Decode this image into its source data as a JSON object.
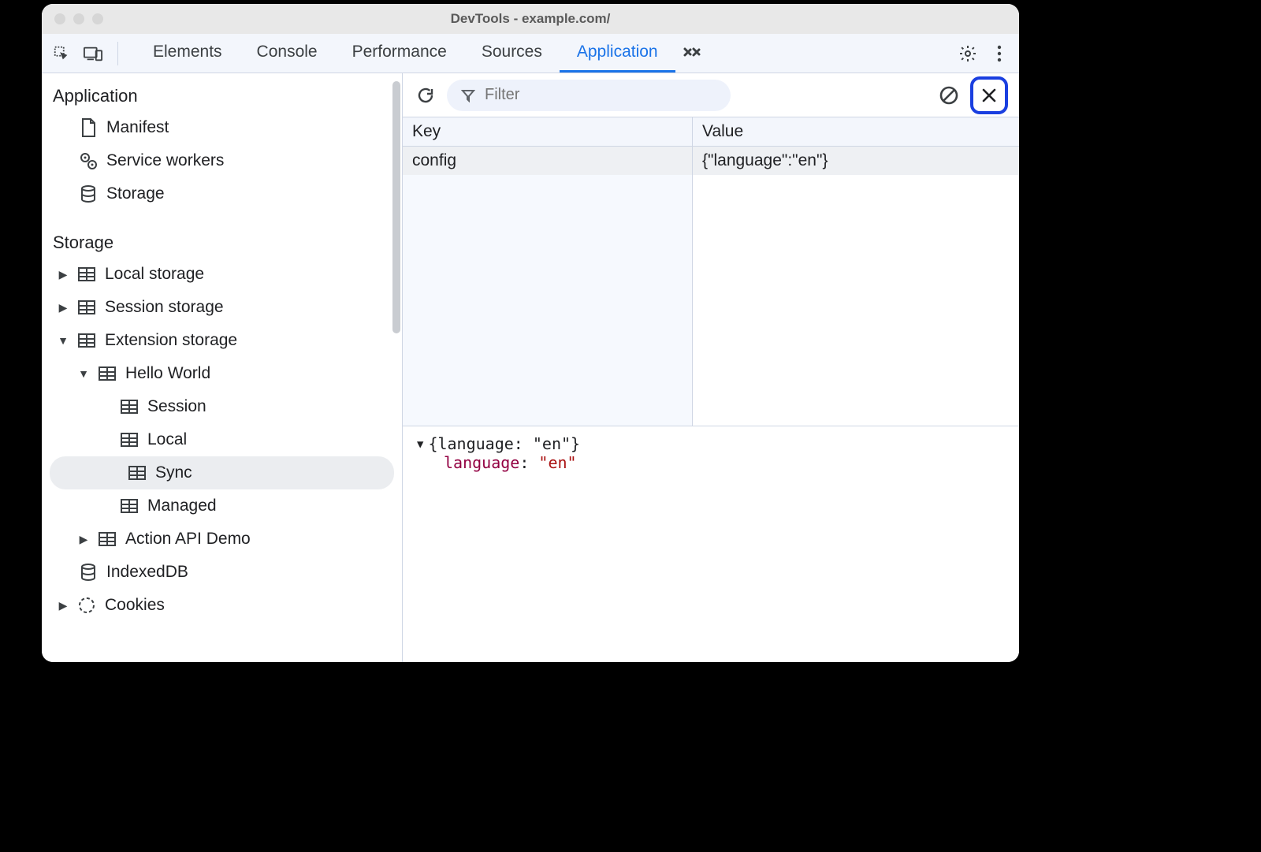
{
  "window": {
    "title": "DevTools - example.com/"
  },
  "tabs": {
    "items": [
      "Elements",
      "Console",
      "Performance",
      "Sources",
      "Application"
    ],
    "active": "Application"
  },
  "sidebar": {
    "sections": {
      "application": {
        "title": "Application",
        "manifest": "Manifest",
        "service_workers": "Service workers",
        "storage": "Storage"
      },
      "storage": {
        "title": "Storage",
        "local_storage": "Local storage",
        "session_storage": "Session storage",
        "extension_storage": "Extension storage",
        "hello_world": "Hello World",
        "session": "Session",
        "local": "Local",
        "sync": "Sync",
        "managed": "Managed",
        "action_api_demo": "Action API Demo",
        "indexeddb": "IndexedDB",
        "cookies": "Cookies"
      }
    }
  },
  "toolbar": {
    "filter_placeholder": "Filter"
  },
  "table": {
    "columns": {
      "key": "Key",
      "value": "Value"
    },
    "rows": [
      {
        "key": "config",
        "value": "{\"language\":\"en\"}"
      }
    ]
  },
  "detail": {
    "summary": "{language: \"en\"}",
    "prop_name": "language",
    "prop_value": "\"en\""
  }
}
